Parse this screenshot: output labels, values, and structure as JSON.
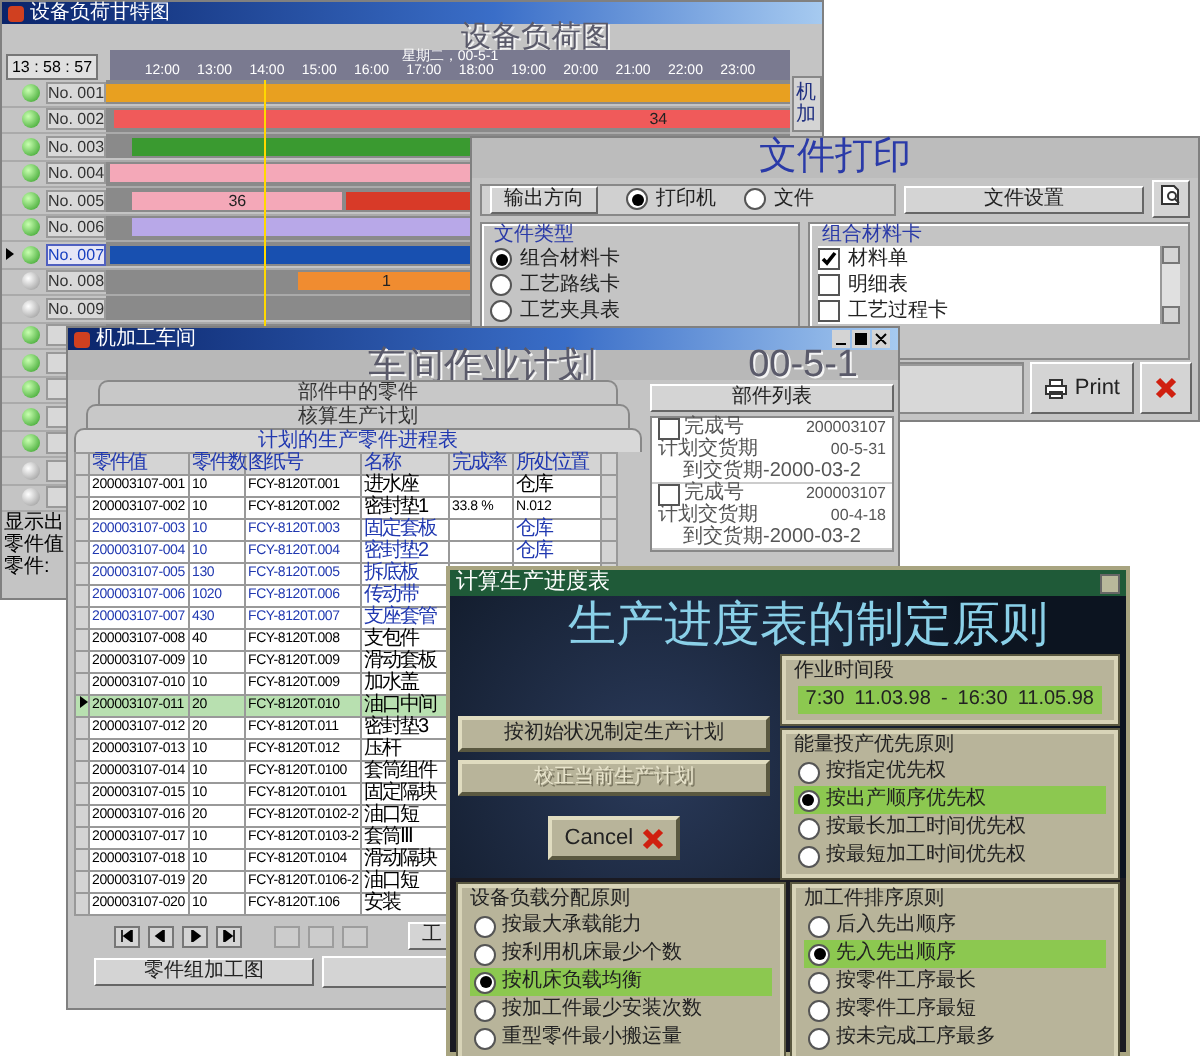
{
  "gantt_window": {
    "title": "设备负荷甘特图",
    "heading": "设备负荷图",
    "clock": "13 : 58 : 57",
    "date": "星期二，00-5-1",
    "side_button": "机加",
    "ticks": [
      "12:00",
      "13:00",
      "14:00",
      "15:00",
      "16:00",
      "17:00",
      "18:00",
      "19:00",
      "20:00",
      "21:00",
      "22:00",
      "23:00"
    ],
    "rows": [
      {
        "label": "No. 001",
        "active": true,
        "selected": false,
        "bars": [
          {
            "color": "#e8a020"
          }
        ]
      },
      {
        "label": "No. 002",
        "active": true,
        "selected": false,
        "bars": [
          {
            "color": "#f05a5a",
            "label": "34"
          }
        ]
      },
      {
        "label": "No. 003",
        "active": true,
        "selected": false,
        "bars": [
          {
            "color": "#3a9a30"
          }
        ]
      },
      {
        "label": "No. 004",
        "active": true,
        "selected": false,
        "bars": [
          {
            "color": "#f4a8b8"
          }
        ]
      },
      {
        "label": "No. 005",
        "active": true,
        "selected": false,
        "bars": [
          {
            "color": "#f4a8b8",
            "label": "36"
          },
          {
            "color": "#d83a28"
          }
        ]
      },
      {
        "label": "No. 006",
        "active": true,
        "selected": false,
        "bars": [
          {
            "color": "#b8a8e8"
          }
        ]
      },
      {
        "label": "No. 007",
        "active": true,
        "selected": true,
        "bars": [
          {
            "color": "#1850b0"
          }
        ]
      },
      {
        "label": "No. 008",
        "active": false,
        "selected": false,
        "bars": [
          {
            "color": "#f08c30",
            "label": "1"
          }
        ]
      },
      {
        "label": "No. 009",
        "active": false,
        "selected": false
      },
      {
        "active": true,
        "selected": false
      },
      {
        "active": true,
        "selected": false
      },
      {
        "active": true,
        "selected": false
      },
      {
        "active": true,
        "selected": false
      },
      {
        "active": true,
        "selected": false
      },
      {
        "active": false,
        "selected": false
      },
      {
        "active": false,
        "selected": false
      }
    ],
    "footer": [
      "显示出",
      "零件值",
      "零件:"
    ]
  },
  "print_window": {
    "title": "文件打印",
    "output_label": "输出方向",
    "outputs": [
      {
        "label": "打印机",
        "selected": true
      },
      {
        "label": "文件",
        "selected": false
      }
    ],
    "settings_button": "文件设置",
    "type_group": {
      "title": "文件类型",
      "options": [
        {
          "label": "组合材料卡",
          "selected": true
        },
        {
          "label": "工艺路线卡",
          "selected": false
        },
        {
          "label": "工艺夹具表",
          "selected": false
        }
      ]
    },
    "card_group": {
      "title": "组合材料卡",
      "items": [
        {
          "label": "材料单",
          "checked": true
        },
        {
          "label": "明细表",
          "checked": false
        },
        {
          "label": "工艺过程卡",
          "checked": false
        }
      ]
    },
    "print_button": "Print"
  },
  "workshop_window": {
    "title": "机加工车间",
    "heading": "车间作业计划",
    "date": "00-5-1",
    "tabs": [
      {
        "label": "部件中的零件",
        "selected": false
      },
      {
        "label": "核算生产计划",
        "selected": false
      },
      {
        "label": "计划的生产零件进程表",
        "selected": true
      }
    ],
    "columns": [
      "零件值",
      "零件数",
      "图纸号",
      "名称",
      "完成率",
      "所处位置"
    ],
    "rows": [
      {
        "cells": [
          "200003107-001",
          "10",
          "FCY-8120T.001",
          "进水座",
          "",
          "仓库"
        ],
        "highlighted": false,
        "selected": false
      },
      {
        "cells": [
          "200003107-002",
          "10",
          "FCY-8120T.002",
          "密封垫1",
          "33.8 %",
          "N.012"
        ],
        "highlighted": false,
        "selected": false
      },
      {
        "cells": [
          "200003107-003",
          "10",
          "FCY-8120T.003",
          "固定套板",
          "",
          "仓库"
        ],
        "highlighted": true,
        "selected": false
      },
      {
        "cells": [
          "200003107-004",
          "10",
          "FCY-8120T.004",
          "密封垫2",
          "",
          "仓库"
        ],
        "highlighted": true,
        "selected": false
      },
      {
        "cells": [
          "200003107-005",
          "130",
          "FCY-8120T.005",
          "拆底板"
        ],
        "highlighted": true,
        "selected": false
      },
      {
        "cells": [
          "200003107-006",
          "1020",
          "FCY-8120T.006",
          "传动带"
        ],
        "highlighted": true,
        "selected": false
      },
      {
        "cells": [
          "200003107-007",
          "430",
          "FCY-8120T.007",
          "支座套管"
        ],
        "highlighted": true,
        "selected": false
      },
      {
        "cells": [
          "200003107-008",
          "40",
          "FCY-8120T.008",
          "支包件"
        ],
        "highlighted": false,
        "selected": false
      },
      {
        "cells": [
          "200003107-009",
          "10",
          "FCY-8120T.009",
          "滑动套板"
        ],
        "highlighted": false,
        "selected": false
      },
      {
        "cells": [
          "200003107-010",
          "10",
          "FCY-8120T.009",
          "加水盖"
        ],
        "highlighted": false,
        "selected": false
      },
      {
        "cells": [
          "200003107-011",
          "20",
          "FCY-8120T.010",
          "油口中间"
        ],
        "highlighted": false,
        "selected": true
      },
      {
        "cells": [
          "200003107-012",
          "20",
          "FCY-8120T.011",
          "密封垫3"
        ],
        "highlighted": false,
        "selected": false
      },
      {
        "cells": [
          "200003107-013",
          "10",
          "FCY-8120T.012",
          "压杆"
        ],
        "highlighted": false,
        "selected": false
      },
      {
        "cells": [
          "200003107-014",
          "10",
          "FCY-8120T.0100",
          "套筒组件"
        ],
        "highlighted": false,
        "selected": false
      },
      {
        "cells": [
          "200003107-015",
          "10",
          "FCY-8120T.0101",
          "固定隔块"
        ],
        "highlighted": false,
        "selected": false
      },
      {
        "cells": [
          "200003107-016",
          "20",
          "FCY-8120T.0102-2",
          "油口短"
        ],
        "highlighted": false,
        "selected": false
      },
      {
        "cells": [
          "200003107-017",
          "10",
          "FCY-8120T.0103-2",
          "套筒Ⅲ"
        ],
        "highlighted": false,
        "selected": false
      },
      {
        "cells": [
          "200003107-018",
          "10",
          "FCY-8120T.0104",
          "滑动隔块"
        ],
        "highlighted": false,
        "selected": false
      },
      {
        "cells": [
          "200003107-019",
          "20",
          "FCY-8120T.0106-2",
          "油口短"
        ],
        "highlighted": false,
        "selected": false
      },
      {
        "cells": [
          "200003107-020",
          "10",
          "FCY-8120T.106",
          "安装"
        ],
        "highlighted": false,
        "selected": false
      }
    ],
    "parts_button": "部件列表",
    "parts": [
      {
        "checked": false,
        "label": "完成号",
        "number": "200003107",
        "date_label": "计划交货期",
        "date": "00-5-31",
        "due": "到交货期-2000-03-2"
      },
      {
        "checked": false,
        "label": "完成号",
        "number": "200003107",
        "date_label": "计划交货期",
        "date": "00-4-18",
        "due": "到交货期-2000-03-2"
      }
    ],
    "tool_button": "工",
    "bottom_button": "零件组加工图"
  },
  "dark_window": {
    "title": "计算生产进度表",
    "heading": "生产进度表的制定原则",
    "time_group": {
      "title": "作业时间段",
      "start_time": "7:30",
      "start_date": "11.03.98",
      "separator": "-",
      "end_time": "16:30",
      "end_date": "11.05.98"
    },
    "buttons": [
      {
        "label": "按初始状况制定生产计划",
        "disabled": false
      },
      {
        "label": "校正当前生产计划",
        "disabled": true
      }
    ],
    "cancel": "Cancel",
    "priority_group": {
      "title": "能量投产优先原则",
      "options": [
        {
          "label": "按指定优先权",
          "selected": false
        },
        {
          "label": "按出产顺序优先权",
          "selected": true
        },
        {
          "label": "按最长加工时间优先权",
          "selected": false
        },
        {
          "label": "按最短加工时间优先权",
          "selected": false
        }
      ]
    },
    "load_group": {
      "title": "设备负载分配原则",
      "options": [
        {
          "label": "按最大承载能力",
          "selected": false
        },
        {
          "label": "按利用机床最少个数",
          "selected": false
        },
        {
          "label": "按机床负载均衡",
          "selected": true
        },
        {
          "label": "按加工件最少安装次数",
          "selected": false
        },
        {
          "label": "重型零件最小搬运量",
          "selected": false
        }
      ]
    },
    "order_group": {
      "title": "加工件排序原则",
      "options": [
        {
          "label": "后入先出顺序",
          "selected": false
        },
        {
          "label": "先入先出顺序",
          "selected": true
        },
        {
          "label": "按零件工序最长",
          "selected": false
        },
        {
          "label": "按零件工序最短",
          "selected": false
        },
        {
          "label": "按未完成工序最多",
          "selected": false
        }
      ]
    }
  }
}
